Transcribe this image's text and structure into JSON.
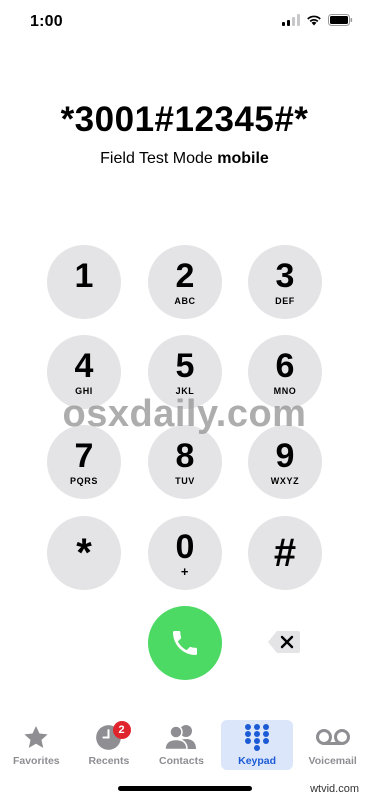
{
  "status_bar": {
    "time": "1:00"
  },
  "dialer": {
    "number": "*3001#12345#*",
    "caption_prefix": "Field Test Mode",
    "caption_bold": "mobile"
  },
  "keys": [
    {
      "digit": "1",
      "letters": ""
    },
    {
      "digit": "2",
      "letters": "ABC"
    },
    {
      "digit": "3",
      "letters": "DEF"
    },
    {
      "digit": "4",
      "letters": "GHI"
    },
    {
      "digit": "5",
      "letters": "JKL"
    },
    {
      "digit": "6",
      "letters": "MNO"
    },
    {
      "digit": "7",
      "letters": "PQRS"
    },
    {
      "digit": "8",
      "letters": "TUV"
    },
    {
      "digit": "9",
      "letters": "WXYZ"
    },
    {
      "digit": "*",
      "letters": ""
    },
    {
      "digit": "0",
      "letters": "+"
    },
    {
      "digit": "#",
      "letters": ""
    }
  ],
  "watermark": "osxdaily.com",
  "tabs": [
    {
      "label": "Favorites",
      "icon": "star-icon",
      "active": false
    },
    {
      "label": "Recents",
      "icon": "clock-icon",
      "active": false,
      "badge": "2"
    },
    {
      "label": "Contacts",
      "icon": "contacts-icon",
      "active": false
    },
    {
      "label": "Keypad",
      "icon": "keypad-icon",
      "active": true
    },
    {
      "label": "Voicemail",
      "icon": "voicemail-icon",
      "active": false
    }
  ],
  "footer_credit": "wtvid.com",
  "colors": {
    "call_green": "#4cd964",
    "key_gray": "#e4e4e6",
    "active_blue": "#1b5bd6",
    "badge_red": "#e0242e"
  }
}
